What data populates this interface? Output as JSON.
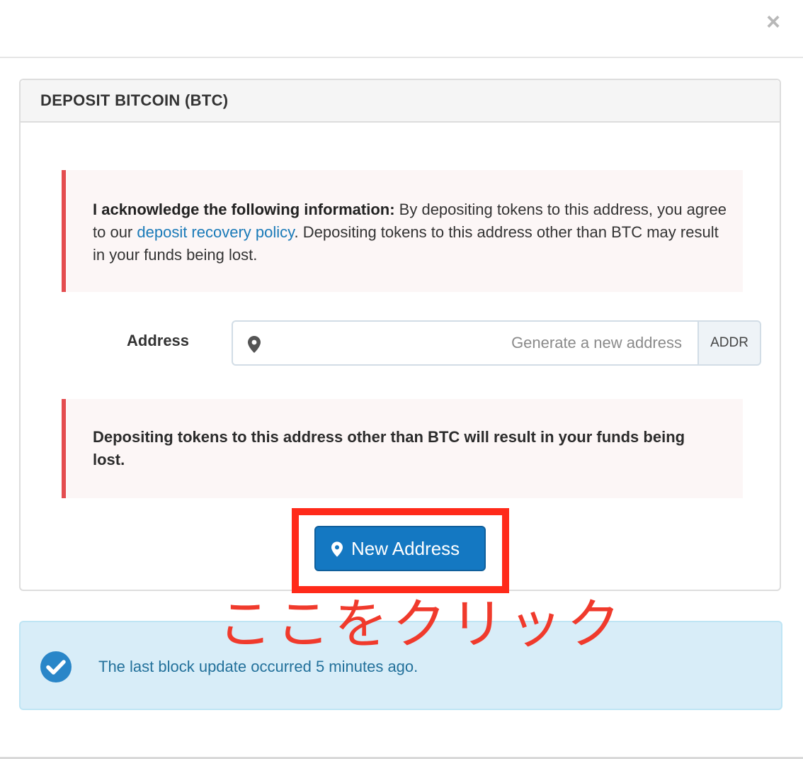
{
  "modal": {
    "close_label": "×"
  },
  "panel": {
    "title": "DEPOSIT BITCOIN (BTC)"
  },
  "acknowledge_alert": {
    "bold": "I acknowledge the following information:",
    "text_before_link": " By depositing tokens to this address, you agree to our ",
    "link": "deposit recovery policy",
    "text_after_link": ". Depositing tokens to this address other than BTC may result in your funds being lost."
  },
  "address_field": {
    "label": "Address",
    "value": "",
    "placeholder": "Generate a new address",
    "left_icon": "map-marker-icon",
    "addon_label": "ADDR"
  },
  "warning_alert": {
    "text": "Depositing tokens to this address other than BTC will result in your funds being lost."
  },
  "new_address_button": {
    "icon": "map-marker-icon",
    "label": "New Address"
  },
  "annotation": {
    "text": "ここをクリック",
    "color": "#f03a2c"
  },
  "info_alert": {
    "icon": "check-circle-icon",
    "text": "The last block update occurred 5 minutes ago."
  },
  "colors": {
    "primary": "#1478c2",
    "danger_border": "#e44c4f",
    "highlight": "#ff2a1a",
    "info_bg": "#d8edf8",
    "info_text": "#23719b",
    "link": "#1a7ab8"
  }
}
